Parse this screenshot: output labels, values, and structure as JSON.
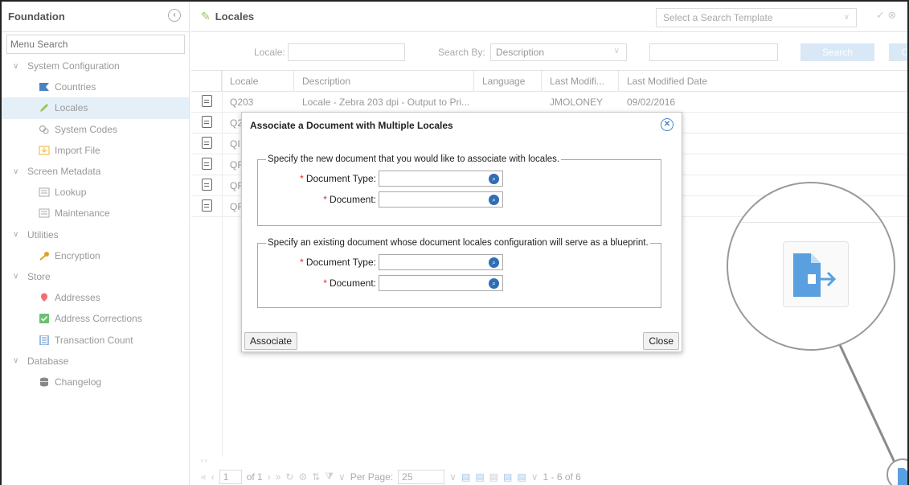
{
  "sidebar": {
    "title": "Foundation",
    "search_placeholder": "Menu Search",
    "groups": [
      {
        "label": "System Configuration",
        "items": [
          {
            "label": "Countries",
            "icon": "flag-icon"
          },
          {
            "label": "Locales",
            "icon": "pencil-icon",
            "active": true
          },
          {
            "label": "System Codes",
            "icon": "codes-icon"
          },
          {
            "label": "Import File",
            "icon": "import-icon"
          }
        ]
      },
      {
        "label": "Screen Metadata",
        "items": [
          {
            "label": "Lookup",
            "icon": "lookup-icon"
          },
          {
            "label": "Maintenance",
            "icon": "maintenance-icon"
          }
        ]
      },
      {
        "label": "Utilities",
        "items": [
          {
            "label": "Encryption",
            "icon": "key-icon"
          }
        ]
      },
      {
        "label": "Store",
        "items": [
          {
            "label": "Addresses",
            "icon": "map-pin-icon"
          },
          {
            "label": "Address Corrections",
            "icon": "check-box-icon"
          },
          {
            "label": "Transaction Count",
            "icon": "calculator-icon"
          }
        ]
      },
      {
        "label": "Database",
        "items": [
          {
            "label": "Changelog",
            "icon": "database-icon"
          }
        ]
      }
    ]
  },
  "header": {
    "title": "Locales",
    "template_placeholder": "Select a Search Template"
  },
  "search": {
    "locale_label": "Locale:",
    "search_by_label": "Search By:",
    "search_by_value": "Description",
    "search_button": "Search",
    "clear_button": "C"
  },
  "grid": {
    "columns": [
      "Locale",
      "Description",
      "Language",
      "Last Modifi...",
      "Last Modified Date"
    ],
    "rows": [
      {
        "locale": "Q203",
        "description": "Locale - Zebra 203 dpi - Output to Pri...",
        "language": "",
        "modified_by": "JMOLONEY",
        "modified_date": "09/02/2016"
      },
      {
        "locale": "Q2",
        "description": "",
        "language": "",
        "modified_by": "",
        "modified_date": ""
      },
      {
        "locale": "QI",
        "description": "",
        "language": "",
        "modified_by": "",
        "modified_date": ""
      },
      {
        "locale": "QF",
        "description": "",
        "language": "",
        "modified_by": "",
        "modified_date": ""
      },
      {
        "locale": "QF",
        "description": "",
        "language": "",
        "modified_by": "",
        "modified_date": ""
      },
      {
        "locale": "QF",
        "description": "",
        "language": "",
        "modified_by": "",
        "modified_date": ""
      }
    ]
  },
  "pager": {
    "page": "1",
    "of_pages": "of 1",
    "per_page_label": "Per Page:",
    "per_page_value": "25",
    "range": "1 - 6 of 6"
  },
  "modal": {
    "title": "Associate a Document with Multiple Locales",
    "section1_legend": "Specify the new document that you would like to associate with locales.",
    "section2_legend": "Specify an existing document whose document locales configuration will serve as a blueprint.",
    "doc_type_label": "Document Type:",
    "document_label": "Document:",
    "required_mark": "*",
    "associate_button": "Associate",
    "close_button": "Close"
  },
  "colors": {
    "accent_blue": "#2f6db4",
    "active_row": "#e5eff8",
    "required": "#d9302c",
    "export_icon": "#5aa0e0"
  }
}
